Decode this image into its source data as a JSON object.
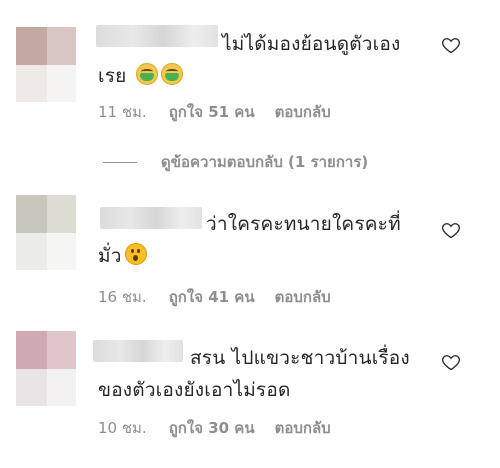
{
  "comments": [
    {
      "text_line1": "ไม่ได้มองย้อนดูตัวเอง",
      "text_line2": "เรย",
      "emojis": [
        "nauseated-face",
        "nauseated-face"
      ],
      "time": "11 ชม.",
      "likes": "ถูกใจ 51 คน",
      "reply": "ตอบกลับ",
      "avatar_colors": [
        "#c4a9a2",
        "#d8c6c2",
        "#efe9e8",
        "#f6f3f3"
      ]
    },
    {
      "text_line1": "ว่าใครคะทนายใครคะที่",
      "text_line2": "มั่ว",
      "emojis": [
        "astonished-face"
      ],
      "time": "16 ชม.",
      "likes": "ถูกใจ 41 คน",
      "reply": "ตอบกลับ",
      "avatar_colors": [
        "#c7c7bd",
        "#dcdcd4",
        "#ececea",
        "#f5f5f3"
      ]
    },
    {
      "text_line1": "สรน ไปแขวะชาวบ้านเรื่อง",
      "text_line2": "ของตัวเองยังเอาไม่รอด",
      "emojis": [],
      "time": "10 ชม.",
      "likes": "ถูกใจ 30 คน",
      "reply": "ตอบกลับ",
      "avatar_colors": [
        "#cfaab2",
        "#dec6cb",
        "#e9e4e5",
        "#f4f1f2"
      ]
    }
  ],
  "view_replies": "ดูข้อความตอบกลับ (1 รายการ)",
  "colors": {
    "text": "#262626",
    "meta": "#8e8e8e",
    "background": "#ffffff"
  }
}
